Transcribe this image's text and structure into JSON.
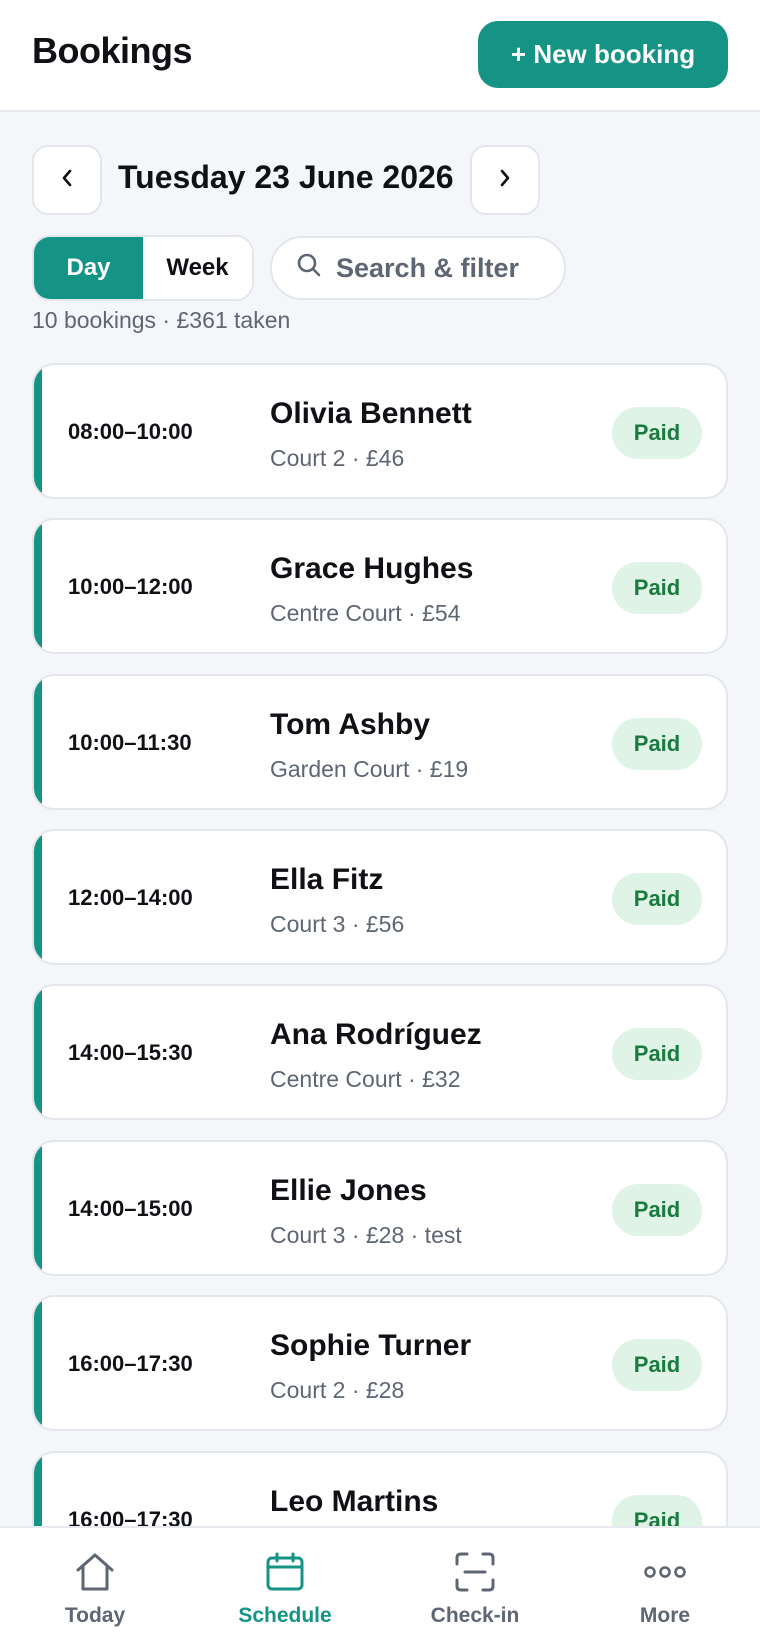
{
  "header": {
    "title": "Bookings",
    "new_booking_label": "+ New booking"
  },
  "date_nav": {
    "prev_glyph": "‹",
    "next_glyph": "›",
    "date": "Tuesday 23 June 2026"
  },
  "view_toggle": {
    "options": [
      "Day",
      "Week"
    ],
    "selected": "Day"
  },
  "search": {
    "label": "Search & filter",
    "icon": "search-icon"
  },
  "summary": "10 bookings · £361 taken",
  "bookings": [
    {
      "time": "08:00–10:00",
      "name": "Olivia Bennett",
      "detail": "Court 2 · £46",
      "status": "Paid"
    },
    {
      "time": "10:00–12:00",
      "name": "Grace Hughes",
      "detail": "Centre Court · £54",
      "status": "Paid"
    },
    {
      "time": "10:00–11:30",
      "name": "Tom Ashby",
      "detail": "Garden Court · £19",
      "status": "Paid"
    },
    {
      "time": "12:00–14:00",
      "name": "Ella Fitz",
      "detail": "Court 3 · £56",
      "status": "Paid"
    },
    {
      "time": "14:00–15:30",
      "name": "Ana Rodríguez",
      "detail": "Centre Court · £32",
      "status": "Paid"
    },
    {
      "time": "14:00–15:00",
      "name": "Ellie Jones",
      "detail": "Court 3 · £28 · test",
      "status": "Paid"
    },
    {
      "time": "16:00–17:30",
      "name": "Sophie Turner",
      "detail": "Court 2 · £28",
      "status": "Paid"
    },
    {
      "time": "16:00–17:30",
      "name": "Leo Martins",
      "detail": "",
      "status": "Paid"
    }
  ],
  "tabbar": {
    "items": [
      {
        "label": "Today",
        "icon": "home-icon"
      },
      {
        "label": "Schedule",
        "icon": "calendar-icon"
      },
      {
        "label": "Check-in",
        "icon": "scan-icon"
      },
      {
        "label": "More",
        "icon": "more-dots-icon"
      }
    ],
    "active": "Schedule"
  },
  "colors": {
    "accent": "#159485",
    "paid_bg": "#dff3e6",
    "paid_text": "#1a7a3f",
    "muted": "#5e6673"
  }
}
